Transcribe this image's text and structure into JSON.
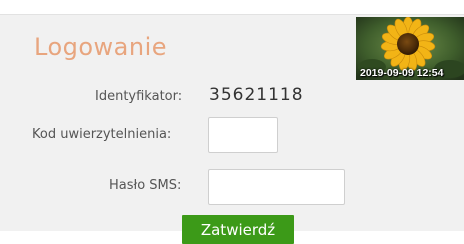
{
  "login": {
    "title": "Logowanie",
    "identifier_label": "Identyfikator:",
    "identifier_value": "35621118",
    "auth_code_label": "Kod uwierzytelnienia:",
    "auth_code_value": "",
    "sms_password_label": "Hasło SMS:",
    "sms_password_value": "",
    "submit_label": "Zatwierdź"
  },
  "photo": {
    "caption": "2019-09-09 12:54",
    "icon": "sunflower-image"
  },
  "colors": {
    "title": "#e8a57e",
    "submit_background": "#3c9a18",
    "panel_background": "#f1f1f1"
  }
}
